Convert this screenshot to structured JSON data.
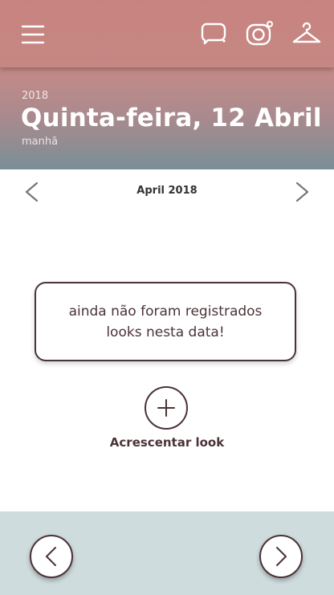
{
  "header": {
    "year": "2018",
    "date_title": "Quinta-feira, 12 Abril",
    "period": "manhã"
  },
  "toolbar": {
    "icons": [
      "menu-icon",
      "chat-bubble-icon",
      "camera-icon",
      "hanger-icon"
    ]
  },
  "calendar": {
    "month_label": "April 2018"
  },
  "empty_state": {
    "message": "ainda não foram registrados\nlooks nesta data!"
  },
  "add": {
    "label": "Acrescentar look"
  },
  "colors": {
    "topbar": "#c9837f",
    "ink": "#4a3337",
    "bottom_band": "#cfdcdd"
  }
}
